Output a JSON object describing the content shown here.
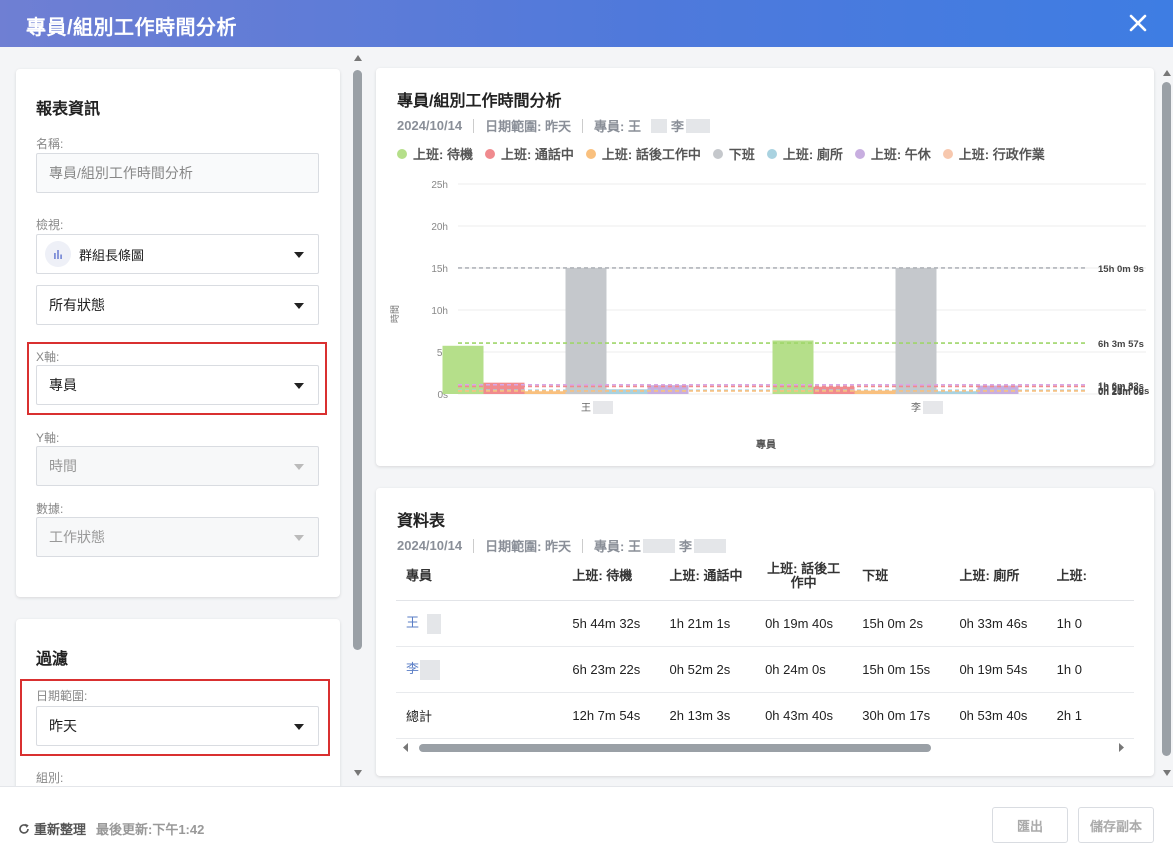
{
  "window": {
    "title": "專員/組別工作時間分析"
  },
  "report_info": {
    "section_title": "報表資訊",
    "name_label": "名稱:",
    "name_value": "專員/組別工作時間分析",
    "view_label": "檢視:",
    "view_value": "群組長條圖",
    "status_value": "所有狀態",
    "x_label": "X軸:",
    "x_value": "專員",
    "y_label": "Y軸:",
    "y_value": "時間",
    "data_label": "數據:",
    "data_value": "工作狀態"
  },
  "filter": {
    "section_title": "過濾",
    "date_label": "日期範圍:",
    "date_value": "昨天",
    "group_label": "組別:"
  },
  "chart_panel": {
    "title": "專員/組別工作時間分析",
    "date": "2024/10/14",
    "range": "日期範圍: 昨天",
    "agents": "專員: 王",
    "agent2": "李"
  },
  "chart_data": {
    "type": "bar",
    "categories": [
      "王",
      "李"
    ],
    "xlabel": "專員",
    "ylabel": "時間",
    "ylim": [
      0,
      25
    ],
    "y_ticks": [
      "0s",
      "5h",
      "10h",
      "15h",
      "20h",
      "25h"
    ],
    "series": [
      {
        "name": "上班: 待機",
        "color": "#b5df8a",
        "values": [
          5.742,
          6.373
        ]
      },
      {
        "name": "上班: 通話中",
        "color": "#f08a8e",
        "values": [
          1.35,
          0.867
        ]
      },
      {
        "name": "上班: 話後工作中",
        "color": "#f9c07e",
        "values": [
          0.328,
          0.4
        ]
      },
      {
        "name": "下班",
        "color": "#c5c8cc",
        "values": [
          15.001,
          15.004
        ]
      },
      {
        "name": "上班: 廁所",
        "color": "#a9d2e0",
        "values": [
          0.563,
          0.332
        ]
      },
      {
        "name": "上班: 午休",
        "color": "#c8aee0",
        "values": [
          1.05,
          1.0
        ]
      },
      {
        "name": "上班: 行政作業",
        "color": "#f7c8ae",
        "values": [
          0,
          0
        ]
      }
    ],
    "reference_lines": [
      {
        "value": 15.0025,
        "label": "15h 0m 9s",
        "color": "#b0b4ba"
      },
      {
        "value": 6.0658,
        "label": "6h 3m 57s",
        "color": "#9fd66a"
      },
      {
        "value": 1.1,
        "label": "1h 6m 33s",
        "color": "#d6a8e8"
      },
      {
        "value": 0.9,
        "label": "1h 0m 0s",
        "color": "#f08a8e"
      },
      {
        "value": 0.45,
        "label": "0h 21m 50s",
        "color": "#a9d2e0"
      },
      {
        "value": 0.36,
        "label": "0h 20m 0s",
        "color": "#f9c07e"
      }
    ]
  },
  "table_panel": {
    "title": "資料表",
    "date": "2024/10/14",
    "range": "日期範圍: 昨天",
    "agents": "專員: 王",
    "agent2": "李",
    "headers": [
      "專員",
      "上班: 待機",
      "上班: 通話中",
      "上班: 話後工\n作中",
      "下班",
      "上班: 廁所",
      "上班:"
    ],
    "rows": [
      [
        "王",
        "5h 44m 32s",
        "1h 21m 1s",
        "0h 19m 40s",
        "15h 0m 2s",
        "0h 33m 46s",
        "1h 0"
      ],
      [
        "李",
        "6h 23m 22s",
        "0h 52m 2s",
        "0h 24m 0s",
        "15h 0m 15s",
        "0h 19m 54s",
        "1h 0"
      ],
      [
        "總計",
        "12h 7m 54s",
        "2h 13m 3s",
        "0h 43m 40s",
        "30h 0m 17s",
        "0h 53m 40s",
        "2h 1"
      ]
    ]
  },
  "footer": {
    "refresh_label": "重新整理",
    "last_update": "最後更新:下午1:42",
    "export_label": "匯出",
    "save_copy_label": "儲存副本"
  }
}
